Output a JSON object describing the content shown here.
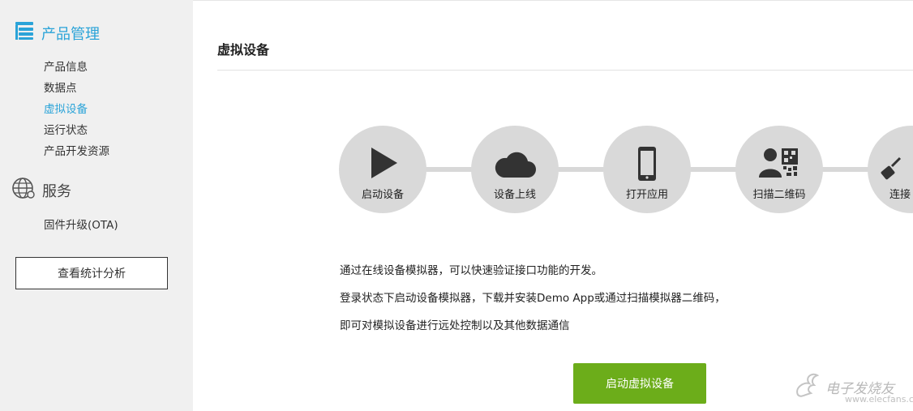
{
  "sidebar": {
    "product_section": {
      "title": "产品管理",
      "icon": "stack-icon"
    },
    "product_items": [
      {
        "label": "产品信息",
        "active": false
      },
      {
        "label": "数据点",
        "active": false
      },
      {
        "label": "虚拟设备",
        "active": true
      },
      {
        "label": "运行状态",
        "active": false
      },
      {
        "label": "产品开发资源",
        "active": false
      }
    ],
    "service_section": {
      "title": "服务",
      "icon": "globe-icon"
    },
    "service_items": [
      {
        "label": "固件升级(OTA)"
      }
    ],
    "stats_button": "查看统计分析"
  },
  "main": {
    "title": "虚拟设备",
    "steps": [
      {
        "label": "启动设备",
        "icon": "play-icon"
      },
      {
        "label": "设备上线",
        "icon": "cloud-icon"
      },
      {
        "label": "打开应用",
        "icon": "phone-icon"
      },
      {
        "label": "扫描二维码",
        "icon": "qr-scan-icon"
      },
      {
        "label": "连接",
        "icon": "plug-icon"
      }
    ],
    "description": [
      "通过在线设备模拟器，可以快速验证接口功能的开发。",
      "登录状态下启动设备模拟器，下载并安装Demo App或通过扫描模拟器二维码，",
      "即可对模拟设备进行远处控制以及其他数据通信"
    ],
    "launch_button": "启动虚拟设备"
  },
  "watermark": {
    "text": "电子发烧友",
    "sub": "www.elecfans.com"
  },
  "colors": {
    "accent": "#2aa3d8",
    "button_green": "#6cad1a",
    "sidebar_bg": "#f0f0f0",
    "step_circle": "#d9d9d9"
  }
}
